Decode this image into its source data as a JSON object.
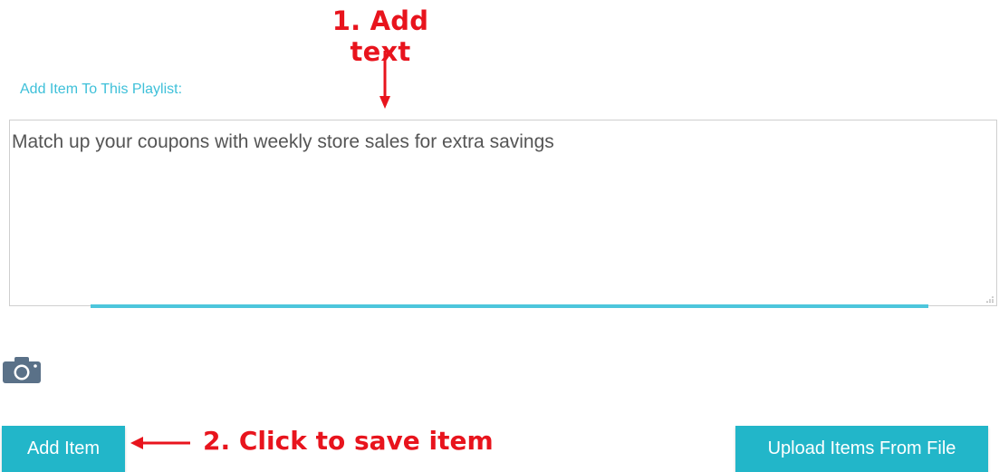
{
  "annotations": {
    "step1": "1. Add text",
    "step2": "2. Click to save item",
    "color": "#e8141d"
  },
  "form": {
    "label": "Add Item To This Playlist:",
    "textarea_value": "Match up your coupons with weekly store sales for extra savings",
    "camera_icon": "camera-icon"
  },
  "buttons": {
    "add_item": "Add Item",
    "upload_items": "Upload Items From File"
  },
  "colors": {
    "accent": "#22b6c9",
    "label": "#3ec0d9",
    "focus_line": "#4dc6dc",
    "camera": "#5a7188"
  }
}
